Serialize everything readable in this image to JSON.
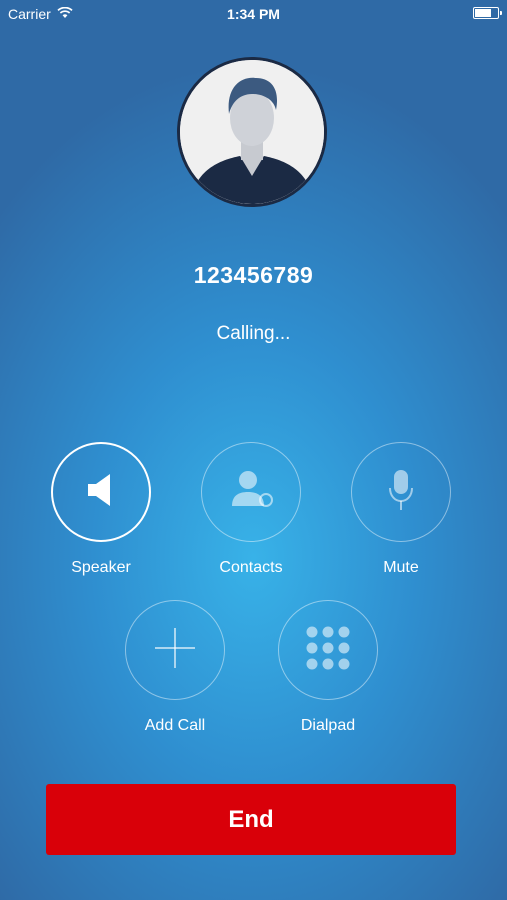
{
  "status_bar": {
    "carrier": "Carrier",
    "time": "1:34 PM",
    "wifi_icon": "wifi-icon",
    "battery_icon": "battery-icon"
  },
  "call": {
    "number": "123456789",
    "status": "Calling..."
  },
  "controls": {
    "speaker": {
      "label": "Speaker",
      "icon": "speaker-icon",
      "active": true
    },
    "contacts": {
      "label": "Contacts",
      "icon": "contacts-icon",
      "active": false
    },
    "mute": {
      "label": "Mute",
      "icon": "microphone-icon",
      "active": false
    },
    "add_call": {
      "label": "Add Call",
      "icon": "plus-icon",
      "active": false
    },
    "dialpad": {
      "label": "Dialpad",
      "icon": "dialpad-icon",
      "active": false
    }
  },
  "end_button": {
    "label": "End"
  },
  "colors": {
    "end": "#d90009",
    "background_center": "#38b2e8",
    "background_edge": "#2f6aa6"
  }
}
